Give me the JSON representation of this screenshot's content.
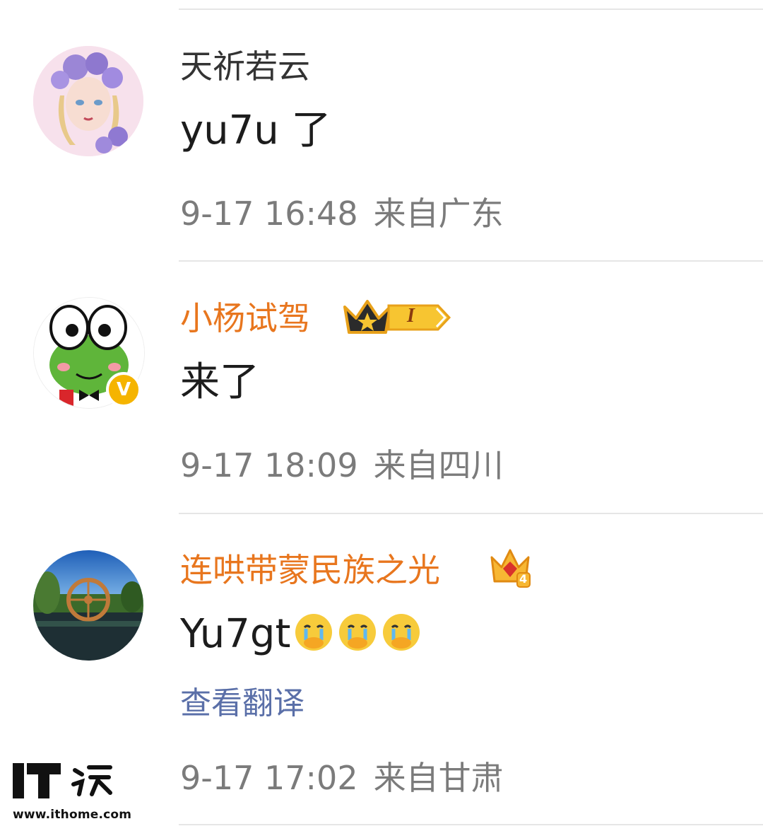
{
  "comments": [
    {
      "name": "天祈若云",
      "text": "yu7u 了",
      "date": "9-17 16:48",
      "location": "来自广东",
      "avatar": "avatar-girl-purple-flowers",
      "name_color": "#333333"
    },
    {
      "name": "小杨试驾",
      "text": "来了",
      "date": "9-17 18:09",
      "location": "来自四川",
      "avatar": "avatar-green-frog",
      "name_color": "#e8761e",
      "badges": [
        "crown-icon",
        "level-tag-icon",
        "verified-v-icon"
      ],
      "level_text": "I",
      "verified_text": "V"
    },
    {
      "name": "连哄带蒙民族之光",
      "text": "Yu7gt",
      "emojis": [
        "crying-face-emoji",
        "crying-face-emoji",
        "crying-face-emoji"
      ],
      "translate_label": "查看翻译",
      "date": "9-17 17:02",
      "location": "来自甘肃",
      "avatar": "avatar-landscape-waterwheel",
      "name_color": "#e8761e",
      "badges": [
        "crown-level-icon"
      ],
      "crown_level_text": "4"
    }
  ],
  "watermark": {
    "logo": "IT之家",
    "url": "www.ithome.com"
  }
}
